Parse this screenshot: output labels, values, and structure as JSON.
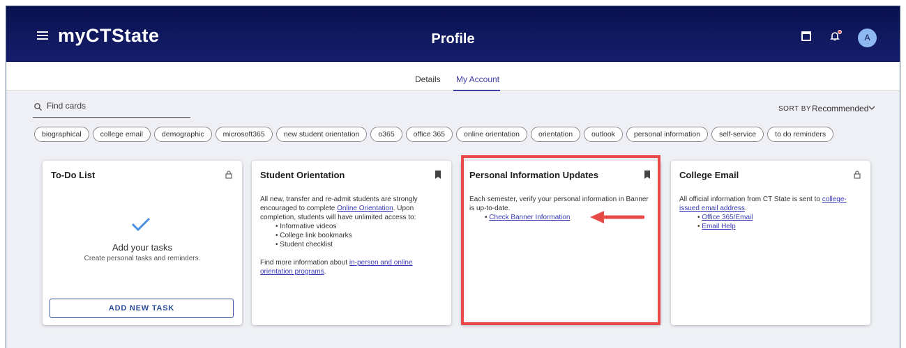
{
  "header": {
    "app_title": "myCTState",
    "page_title": "Profile",
    "avatar_initial": "A"
  },
  "tabs": [
    {
      "label": "Details",
      "active": false
    },
    {
      "label": "My Account",
      "active": true
    }
  ],
  "search": {
    "placeholder": "Find cards"
  },
  "sort": {
    "label": "SORT BY",
    "value": "Recommended"
  },
  "chips": [
    "biographical",
    "college email",
    "demographic",
    "microsoft365",
    "new student orientation",
    "o365",
    "office 365",
    "online orientation",
    "orientation",
    "outlook",
    "personal information",
    "self-service",
    "to do reminders"
  ],
  "cards": {
    "todo": {
      "title": "To-Do List",
      "heading": "Add your tasks",
      "sub": "Create personal tasks and reminders.",
      "button": "ADD NEW TASK"
    },
    "orientation": {
      "title": "Student Orientation",
      "p1_a": "All new, transfer and re-admit students are strongly encouraged to complete ",
      "p1_link": "Online Orientation",
      "p1_b": ".  Upon completion, students will have unlimited access to:",
      "bullets": [
        "Informative videos",
        "College link bookmarks",
        "Student checklist"
      ],
      "p2_a": "Find more information about ",
      "p2_link": "in-person and online orientation programs",
      "p2_b": "."
    },
    "personal": {
      "title": "Personal Information Updates",
      "p1": "Each semester, verify your personal information in Banner is up-to-date.",
      "link": "Check Banner Information"
    },
    "email": {
      "title": "College Email",
      "p1_a": "All official information from CT State is sent to ",
      "p1_link": "college-issued email address",
      "p1_b": ".",
      "links": [
        "Office 365/Email",
        "Email Help"
      ]
    }
  },
  "colors": {
    "header_bg": "#0a1150",
    "accent": "#3f3fa8",
    "highlight": "#e84a4a"
  }
}
